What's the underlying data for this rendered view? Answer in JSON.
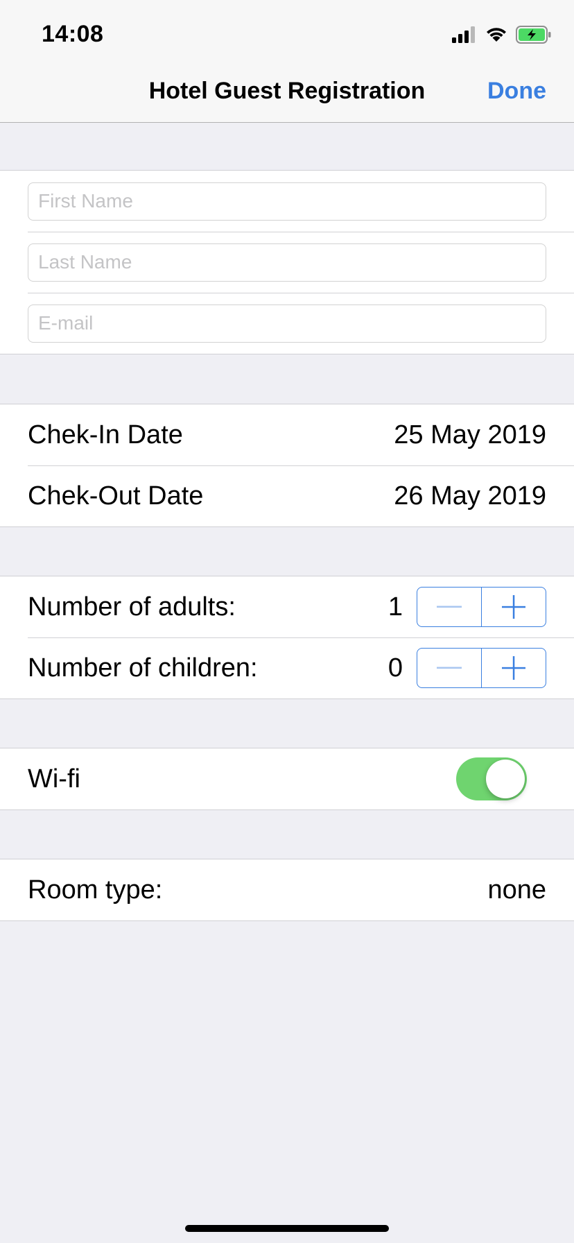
{
  "status_bar": {
    "time": "14:08"
  },
  "nav": {
    "title": "Hotel Guest Registration",
    "done_label": "Done"
  },
  "guest_fields": {
    "first_name": {
      "placeholder": "First Name",
      "value": ""
    },
    "last_name": {
      "placeholder": "Last Name",
      "value": ""
    },
    "email": {
      "placeholder": "E-mail",
      "value": ""
    }
  },
  "dates": {
    "check_in_label": "Chek-In Date",
    "check_in_value": "25 May 2019",
    "check_out_label": "Chek-Out Date",
    "check_out_value": "26 May 2019"
  },
  "guests": {
    "adults_label": "Number of adults:",
    "adults_value": "1",
    "children_label": "Number of children:",
    "children_value": "0"
  },
  "wifi": {
    "label": "Wi-fi",
    "enabled": true
  },
  "room": {
    "label": "Room type:",
    "value": "none"
  },
  "colors": {
    "accent": "#3a7fe0",
    "toggle_on": "#6fd46f",
    "background": "#efeff4",
    "battery": "#4cd964"
  },
  "icons": [
    "signal-icon",
    "wifi-icon",
    "battery-charging-icon",
    "minus-icon",
    "plus-icon"
  ]
}
